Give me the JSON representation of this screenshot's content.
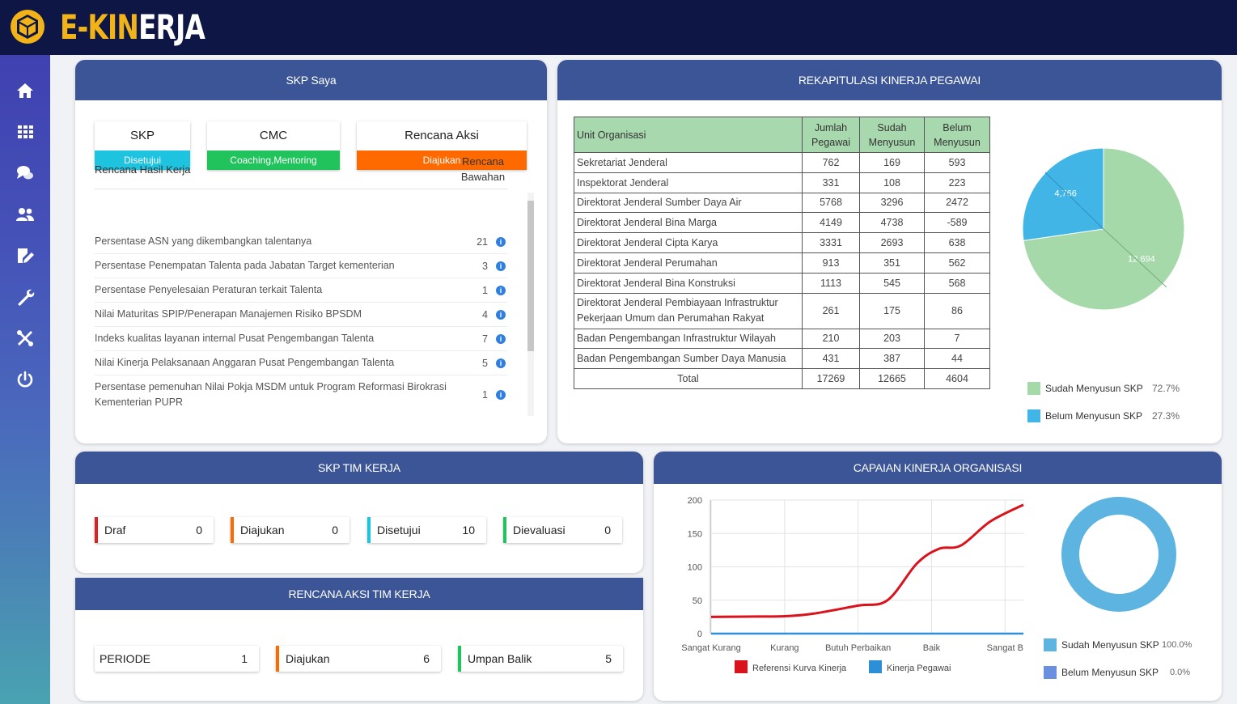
{
  "app": {
    "logo_part1": "E-KIN",
    "logo_part2": "ERJA"
  },
  "sidebar": {
    "icons": [
      "home-icon",
      "grid-icon",
      "chat-icon",
      "users-icon",
      "edit-document-icon",
      "wrench-icon",
      "tools-icon",
      "power-icon"
    ]
  },
  "skp_saya": {
    "title": "SKP Saya",
    "tiles": [
      {
        "label": "SKP",
        "status": "Disetujui",
        "color": "#1ec3df"
      },
      {
        "label": "CMC",
        "status": "Coaching,Mentoring",
        "color": "#21c35c"
      },
      {
        "label": "Rencana Aksi",
        "status": "Diajukan",
        "color": "#ff6a00"
      }
    ],
    "col_rhk": "Rencana Hasil Kerja",
    "col_rencana": "Rencana",
    "col_bawahan": "Bawahan",
    "rows": [
      {
        "text": "Persentase ASN yang dikembangkan talentanya",
        "count": "21"
      },
      {
        "text": "Persentase Penempatan Talenta pada Jabatan Target kementerian",
        "count": "3"
      },
      {
        "text": "Persentase Penyelesaian Peraturan terkait Talenta",
        "count": "1"
      },
      {
        "text": "Nilai Maturitas SPIP/Penerapan Manajemen Risiko BPSDM",
        "count": "4"
      },
      {
        "text": "Indeks kualitas layanan internal Pusat Pengembangan Talenta",
        "count": "7"
      },
      {
        "text": "Nilai Kinerja Pelaksanaan Anggaran Pusat Pengembangan Talenta",
        "count": "5"
      },
      {
        "text": "Persentase pemenuhan Nilai Pokja MSDM untuk Program Reformasi Birokrasi Kementerian PUPR",
        "count": "1"
      }
    ]
  },
  "rekap": {
    "title": "REKAPITULASI KINERJA PEGAWAI",
    "headers": {
      "unit": "Unit Organisasi",
      "jumlah": [
        "Jumlah",
        "Pegawai"
      ],
      "sudah": [
        "Sudah",
        "Menyusun"
      ],
      "belum": [
        "Belum",
        "Menyusun"
      ]
    },
    "rows": [
      {
        "unit": "Sekretariat Jenderal",
        "jumlah": "762",
        "sudah": "169",
        "belum": "593"
      },
      {
        "unit": "Inspektorat Jenderal",
        "jumlah": "331",
        "sudah": "108",
        "belum": "223"
      },
      {
        "unit": "Direktorat Jenderal Sumber Daya Air",
        "jumlah": "5768",
        "sudah": "3296",
        "belum": "2472"
      },
      {
        "unit": "Direktorat Jenderal Bina Marga",
        "jumlah": "4149",
        "sudah": "4738",
        "belum": "-589"
      },
      {
        "unit": "Direktorat Jenderal Cipta Karya",
        "jumlah": "3331",
        "sudah": "2693",
        "belum": "638"
      },
      {
        "unit": "Direktorat Jenderal Perumahan",
        "jumlah": "913",
        "sudah": "351",
        "belum": "562"
      },
      {
        "unit": "Direktorat Jenderal Bina Konstruksi",
        "jumlah": "1113",
        "sudah": "545",
        "belum": "568"
      },
      {
        "unit": "Direktorat Jenderal Pembiayaan Infrastruktur Pekerjaan Umum dan Perumahan Rakyat",
        "jumlah": "261",
        "sudah": "175",
        "belum": "86"
      },
      {
        "unit": "Badan Pengembangan Infrastruktur Wilayah",
        "jumlah": "210",
        "sudah": "203",
        "belum": "7"
      },
      {
        "unit": "Badan Pengembangan Sumber Daya Manusia",
        "jumlah": "431",
        "sudah": "387",
        "belum": "44"
      }
    ],
    "total": {
      "label": "Total",
      "jumlah": "17269",
      "sudah": "12665",
      "belum": "4604"
    },
    "pie": {
      "slices": [
        {
          "name": "Sudah Menyusun SKP",
          "value": 12694,
          "label": "12,694",
          "pct": "72.7%",
          "color": "#a6d9aa"
        },
        {
          "name": "Belum Menyusun SKP",
          "value": 4766,
          "label": "4,766",
          "pct": "27.3%",
          "color": "#41b6e6"
        }
      ]
    }
  },
  "skp_tim": {
    "title": "SKP TIM KERJA",
    "stats": [
      {
        "label": "Draf",
        "value": "0",
        "color": "#e02020"
      },
      {
        "label": "Diajukan",
        "value": "0",
        "color": "#ff6a00"
      },
      {
        "label": "Disetujui",
        "value": "10",
        "color": "#1ec3df"
      },
      {
        "label": "Dievaluasi",
        "value": "0",
        "color": "#21c35c"
      }
    ]
  },
  "rencana_tim": {
    "title": "RENCANA AKSI TIM KERJA",
    "stats": [
      {
        "label": "PERIODE",
        "value": "1",
        "color": ""
      },
      {
        "label": "Diajukan",
        "value": "6",
        "color": "#ff6a00"
      },
      {
        "label": "Umpan Balik",
        "value": "5",
        "color": "#21c35c"
      }
    ]
  },
  "capaian": {
    "title": "CAPAIAN KINERJA ORGANISASI",
    "donut": {
      "slices": [
        {
          "name": "Sudah Menyusun SKP",
          "value": 100.0,
          "pct": "100.0%",
          "color": "#5db4e0"
        },
        {
          "name": "Belum Menyusun SKP",
          "value": 0.0,
          "pct": "0.0%",
          "color": "#6a8fe0"
        }
      ]
    }
  },
  "chart_data": {
    "type": "line",
    "title": "",
    "xlabel": "",
    "ylabel": "",
    "categories": [
      "Sangat Kurang",
      "Kurang",
      "Butuh Perbaikan",
      "Baik",
      "Sangat Baik"
    ],
    "category_labels_shown": [
      "Sangat Kurang",
      "Kurang",
      "Butuh Perbaikan",
      "Baik",
      "Sangat B"
    ],
    "ylim": [
      0,
      200
    ],
    "yticks": [
      0,
      50,
      100,
      150,
      200
    ],
    "grid": true,
    "legend": "bottom",
    "series": [
      {
        "name": "Referensi Kurva Kinerja",
        "color": "#d9121b",
        "points": [
          [
            0,
            25
          ],
          [
            0.5,
            25.5
          ],
          [
            1,
            26
          ],
          [
            1.4,
            30
          ],
          [
            2,
            42
          ],
          [
            2.4,
            50
          ],
          [
            2.8,
            105
          ],
          [
            3.1,
            127
          ],
          [
            3.4,
            132
          ],
          [
            3.8,
            168
          ],
          [
            4.25,
            193
          ]
        ]
      },
      {
        "name": "Kinerja Pegawai",
        "color": "#2d8fd6",
        "points": [
          [
            0,
            0
          ],
          [
            1,
            0
          ],
          [
            2,
            0
          ],
          [
            3,
            0
          ],
          [
            4,
            0
          ],
          [
            4.25,
            0
          ]
        ]
      }
    ]
  }
}
